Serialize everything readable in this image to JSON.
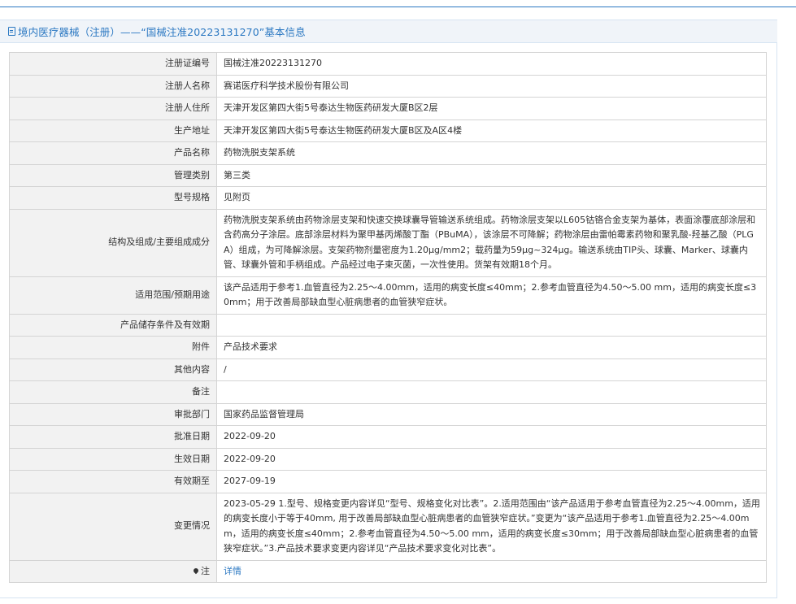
{
  "header": {
    "title": "境内医疗器械（注册）——“国械注准20223131270”基本信息",
    "icon": "document-icon",
    "accent_color": "#2b78c2"
  },
  "rows": [
    {
      "label": "注册证编号",
      "value": "国械注准20223131270"
    },
    {
      "label": "注册人名称",
      "value": "赛诺医疗科学技术股份有限公司"
    },
    {
      "label": "注册人住所",
      "value": "天津开发区第四大街5号泰达生物医药研发大厦B区2层"
    },
    {
      "label": "生产地址",
      "value": "天津开发区第四大街5号泰达生物医药研发大厦B区及A区4楼"
    },
    {
      "label": "产品名称",
      "value": "药物洗脱支架系统"
    },
    {
      "label": "管理类别",
      "value": "第三类"
    },
    {
      "label": "型号规格",
      "value": "见附页"
    },
    {
      "label": "结构及组成/主要组成成分",
      "value": "药物洗脱支架系统由药物涂层支架和快速交换球囊导管输送系统组成。药物涂层支架以L605钴铬合金支架为基体，表面涂覆底部涂层和含药高分子涂层。底部涂层材料为聚甲基丙烯酸丁酯（PBuMA），该涂层不可降解；药物涂层由雷帕霉素药物和聚乳酸-羟基乙酸（PLGA）组成，为可降解涂层。支架药物剂量密度为1.20μg/mm2；载药量为59μg~324μg。输送系统由TIP头、球囊、Marker、球囊内管、球囊外管和手柄组成。产品经过电子束灭菌，一次性使用。货架有效期18个月。"
    },
    {
      "label": "适用范围/预期用途",
      "value": "该产品适用于参考1.血管直径为2.25～4.00mm，适用的病变长度≤40mm；2.参考血管直径为4.50～5.00 mm，适用的病变长度≤30mm；用于改善局部缺血型心脏病患者的血管狭窄症状。"
    },
    {
      "label": "产品储存条件及有效期",
      "value": ""
    },
    {
      "label": "附件",
      "value": "产品技术要求"
    },
    {
      "label": "其他内容",
      "value": "/"
    },
    {
      "label": "备注",
      "value": ""
    },
    {
      "label": "审批部门",
      "value": "国家药品监督管理局"
    },
    {
      "label": "批准日期",
      "value": "2022-09-20"
    },
    {
      "label": "生效日期",
      "value": "2022-09-20"
    },
    {
      "label": "有效期至",
      "value": "2027-09-19"
    },
    {
      "label": "变更情况",
      "value": "2023-05-29 1.型号、规格变更内容详见“型号、规格变化对比表”。2.适用范围由“该产品适用于参考血管直径为2.25～4.00mm，适用的病变长度小于等于40mm, 用于改善局部缺血型心脏病患者的血管狭窄症状。”变更为“该产品适用于参考1.血管直径为2.25～4.00mm，适用的病变长度≤40mm；2.参考血管直径为4.50～5.00 mm，适用的病变长度≤30mm；用于改善局部缺血型心脏病患者的血管狭窄症状。”3.产品技术要求变更内容详见“产品技术要求变化对比表”。"
    }
  ],
  "note_row": {
    "label": "注",
    "icon": "pin-icon",
    "link_text": "详情"
  }
}
